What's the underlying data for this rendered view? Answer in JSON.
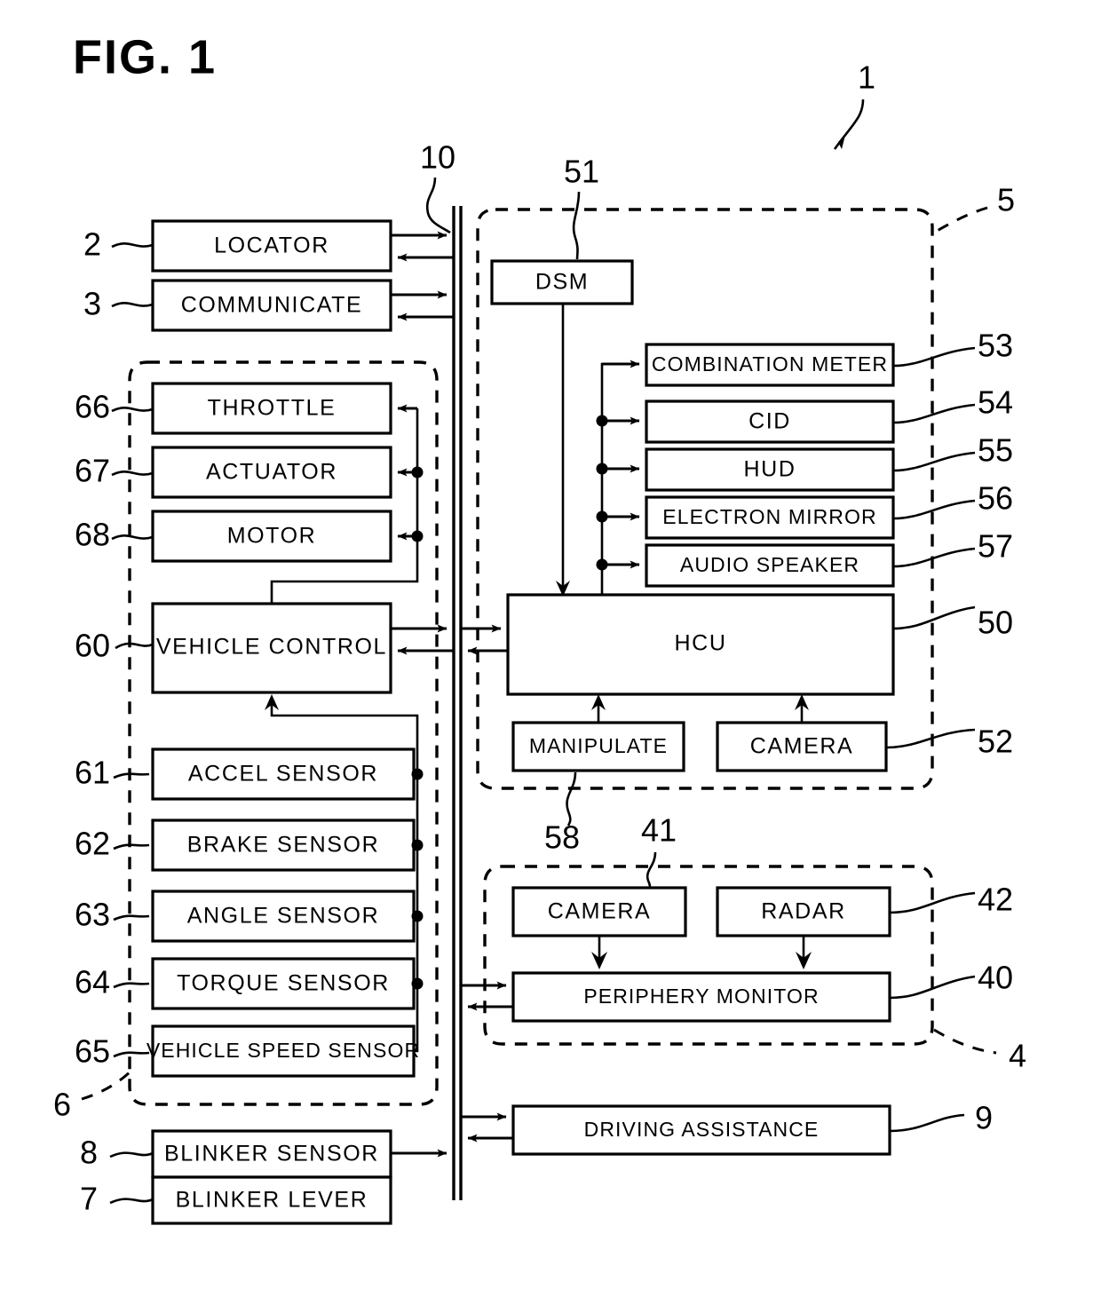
{
  "figure": {
    "title": "FIG. 1",
    "system_ref": "1"
  },
  "bus": {
    "ref": "10"
  },
  "left_blocks": [
    {
      "ref": "2",
      "label": "LOCATOR"
    },
    {
      "ref": "3",
      "label": "COMMUNICATE"
    },
    {
      "ref": "66",
      "label": "THROTTLE"
    },
    {
      "ref": "67",
      "label": "ACTUATOR"
    },
    {
      "ref": "68",
      "label": "MOTOR"
    },
    {
      "ref": "60",
      "label": "VEHICLE CONTROL"
    },
    {
      "ref": "61",
      "label": "ACCEL SENSOR"
    },
    {
      "ref": "62",
      "label": "BRAKE SENSOR"
    },
    {
      "ref": "63",
      "label": "ANGLE SENSOR"
    },
    {
      "ref": "64",
      "label": "TORQUE SENSOR"
    },
    {
      "ref": "65",
      "label": "VEHICLE SPEED SENSOR"
    },
    {
      "ref": "8",
      "label": "BLINKER SENSOR"
    },
    {
      "ref": "7",
      "label": "BLINKER LEVER"
    }
  ],
  "left_group": {
    "ref": "6"
  },
  "hmi_group": {
    "ref": "5",
    "blocks": [
      {
        "ref": "51",
        "label": "DSM"
      },
      {
        "ref": "53",
        "label": "COMBINATION METER"
      },
      {
        "ref": "54",
        "label": "CID"
      },
      {
        "ref": "55",
        "label": "HUD"
      },
      {
        "ref": "56",
        "label": "ELECTRON MIRROR"
      },
      {
        "ref": "57",
        "label": "AUDIO SPEAKER"
      },
      {
        "ref": "50",
        "label": "HCU"
      },
      {
        "ref": "58",
        "label": "MANIPULATE"
      },
      {
        "ref": "52",
        "label": "CAMERA"
      }
    ]
  },
  "periphery_group": {
    "ref": "4",
    "blocks": [
      {
        "ref": "41",
        "label": "CAMERA"
      },
      {
        "ref": "42",
        "label": "RADAR"
      },
      {
        "ref": "40",
        "label": "PERIPHERY MONITOR"
      }
    ]
  },
  "driving_assistance": {
    "ref": "9",
    "label": "DRIVING ASSISTANCE"
  }
}
